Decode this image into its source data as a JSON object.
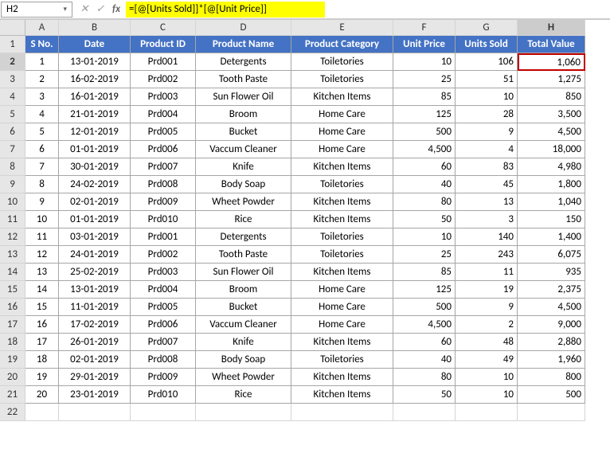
{
  "name_box": "H2",
  "formula": "=[@[Units Sold]]*[@[Unit Price]]",
  "icons": {
    "dd": "▾",
    "cancel": "✕",
    "accept": "✓",
    "fx": "fx"
  },
  "col_labels": [
    "A",
    "B",
    "C",
    "D",
    "E",
    "F",
    "G",
    "H"
  ],
  "row_labels": [
    "1",
    "2",
    "3",
    "4",
    "5",
    "6",
    "7",
    "8",
    "9",
    "10",
    "11",
    "12",
    "13",
    "14",
    "15",
    "16",
    "17",
    "18",
    "19",
    "20",
    "21",
    "22"
  ],
  "headers": [
    "S No.",
    "Date",
    "Product ID",
    "Product Name",
    "Product Category",
    "Unit Price",
    "Units Sold",
    "Total Value"
  ],
  "rows": [
    {
      "sno": "1",
      "date": "13-01-2019",
      "pid": "Prd001",
      "pname": "Detergents",
      "pcat": "Toiletories",
      "uprice": "10",
      "usold": "106",
      "tval": "1,060"
    },
    {
      "sno": "2",
      "date": "16-02-2019",
      "pid": "Prd002",
      "pname": "Tooth Paste",
      "pcat": "Toiletories",
      "uprice": "25",
      "usold": "51",
      "tval": "1,275"
    },
    {
      "sno": "3",
      "date": "16-01-2019",
      "pid": "Prd003",
      "pname": "Sun Flower Oil",
      "pcat": "Kitchen Items",
      "uprice": "85",
      "usold": "10",
      "tval": "850"
    },
    {
      "sno": "4",
      "date": "21-01-2019",
      "pid": "Prd004",
      "pname": "Broom",
      "pcat": "Home Care",
      "uprice": "125",
      "usold": "28",
      "tval": "3,500"
    },
    {
      "sno": "5",
      "date": "12-01-2019",
      "pid": "Prd005",
      "pname": "Bucket",
      "pcat": "Home Care",
      "uprice": "500",
      "usold": "9",
      "tval": "4,500"
    },
    {
      "sno": "6",
      "date": "01-01-2019",
      "pid": "Prd006",
      "pname": "Vaccum Cleaner",
      "pcat": "Home Care",
      "uprice": "4,500",
      "usold": "4",
      "tval": "18,000"
    },
    {
      "sno": "7",
      "date": "30-01-2019",
      "pid": "Prd007",
      "pname": "Knife",
      "pcat": "Kitchen Items",
      "uprice": "60",
      "usold": "83",
      "tval": "4,980"
    },
    {
      "sno": "8",
      "date": "24-02-2019",
      "pid": "Prd008",
      "pname": "Body Soap",
      "pcat": "Toiletories",
      "uprice": "40",
      "usold": "45",
      "tval": "1,800"
    },
    {
      "sno": "9",
      "date": "02-01-2019",
      "pid": "Prd009",
      "pname": "Wheet Powder",
      "pcat": "Kitchen Items",
      "uprice": "80",
      "usold": "13",
      "tval": "1,040"
    },
    {
      "sno": "10",
      "date": "01-01-2019",
      "pid": "Prd010",
      "pname": "Rice",
      "pcat": "Kitchen Items",
      "uprice": "50",
      "usold": "3",
      "tval": "150"
    },
    {
      "sno": "11",
      "date": "03-01-2019",
      "pid": "Prd001",
      "pname": "Detergents",
      "pcat": "Toiletories",
      "uprice": "10",
      "usold": "140",
      "tval": "1,400"
    },
    {
      "sno": "12",
      "date": "24-01-2019",
      "pid": "Prd002",
      "pname": "Tooth Paste",
      "pcat": "Toiletories",
      "uprice": "25",
      "usold": "243",
      "tval": "6,075"
    },
    {
      "sno": "13",
      "date": "25-02-2019",
      "pid": "Prd003",
      "pname": "Sun Flower Oil",
      "pcat": "Kitchen Items",
      "uprice": "85",
      "usold": "11",
      "tval": "935"
    },
    {
      "sno": "14",
      "date": "13-01-2019",
      "pid": "Prd004",
      "pname": "Broom",
      "pcat": "Home Care",
      "uprice": "125",
      "usold": "19",
      "tval": "2,375"
    },
    {
      "sno": "15",
      "date": "11-01-2019",
      "pid": "Prd005",
      "pname": "Bucket",
      "pcat": "Home Care",
      "uprice": "500",
      "usold": "9",
      "tval": "4,500"
    },
    {
      "sno": "16",
      "date": "17-02-2019",
      "pid": "Prd006",
      "pname": "Vaccum Cleaner",
      "pcat": "Home Care",
      "uprice": "4,500",
      "usold": "2",
      "tval": "9,000"
    },
    {
      "sno": "17",
      "date": "26-01-2019",
      "pid": "Prd007",
      "pname": "Knife",
      "pcat": "Kitchen Items",
      "uprice": "60",
      "usold": "48",
      "tval": "2,880"
    },
    {
      "sno": "18",
      "date": "02-01-2019",
      "pid": "Prd008",
      "pname": "Body Soap",
      "pcat": "Toiletories",
      "uprice": "40",
      "usold": "49",
      "tval": "1,960"
    },
    {
      "sno": "19",
      "date": "29-01-2019",
      "pid": "Prd009",
      "pname": "Wheet Powder",
      "pcat": "Kitchen Items",
      "uprice": "80",
      "usold": "10",
      "tval": "800"
    },
    {
      "sno": "20",
      "date": "23-01-2019",
      "pid": "Prd010",
      "pname": "Rice",
      "pcat": "Kitchen Items",
      "uprice": "50",
      "usold": "10",
      "tval": "500"
    }
  ]
}
